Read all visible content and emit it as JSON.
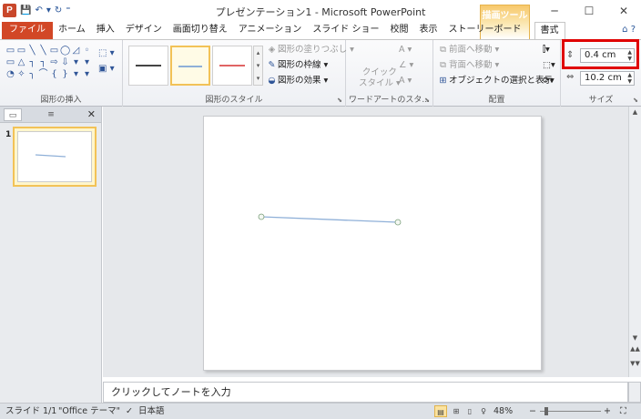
{
  "app": {
    "icon_letter": "P",
    "title": "プレゼンテーション1 - Microsoft PowerPoint",
    "context_tab_group": "描画ツール"
  },
  "qat": {
    "save": "💾",
    "undo": "↶",
    "undo_arrow": "▾",
    "redo": "↻",
    "customize": "⁼"
  },
  "window_controls": {
    "minimize": "─",
    "maximize": "☐",
    "close": "✕"
  },
  "tabs": [
    "ファイル",
    "ホーム",
    "挿入",
    "デザイン",
    "画面切り替え",
    "アニメーション",
    "スライド ショー",
    "校閲",
    "表示",
    "ストーリーボード",
    "書式"
  ],
  "tab_right_icons": {
    "collapse": "⌂",
    "help": "?"
  },
  "ribbon": {
    "insert_shapes": {
      "label": "図形の挿入",
      "shapes": [
        "▭",
        "▭",
        "╲",
        "╲",
        "▭",
        "◯",
        "◿",
        "◦",
        "▭",
        "△",
        "┐",
        "┐",
        "⇨",
        "⇩",
        "▾",
        "▾",
        "◔",
        "✧",
        "╮",
        "⌒",
        "{",
        "}",
        "▾",
        "▾"
      ],
      "side_edit": "⬚ ▾",
      "side_text": "▣ ▾"
    },
    "shape_styles": {
      "label": "図形のスタイル",
      "fill": "図形の塗りつぶし",
      "outline": "図形の枠線",
      "effects": "図形の効果",
      "fill_arrow": "▾",
      "outline_arrow": "▾",
      "effects_arrow": "▾",
      "gallery_colors": [
        "#444444",
        "#8fb0d8",
        "#e06464"
      ]
    },
    "wordart": {
      "label": "ワードアートのスタ...",
      "quick_style_1": "クイック",
      "quick_style_2": "スタイル ▾"
    },
    "arrange": {
      "label": "配置",
      "bring_forward": "前面へ移動",
      "send_backward": "背面へ移動",
      "selection_pane": "オブジェクトの選択と表示",
      "arrow": "▾"
    },
    "size": {
      "label": "サイズ",
      "height": "0.4 cm",
      "width": "10.2 cm"
    }
  },
  "slides_panel": {
    "slide_number": "1",
    "close": "✕",
    "tab_slides": "▭",
    "tab_outline": "≡"
  },
  "notes": {
    "placeholder": "クリックしてノートを入力"
  },
  "status": {
    "slide_info": "スライド 1/1",
    "theme": "\"Office テーマ\"",
    "language": "日本語",
    "zoom": "48%",
    "zoom_minus": "−",
    "zoom_plus": "+"
  },
  "colors": {
    "file_tab": "#d24726",
    "context_tab": "#f7c86b",
    "highlight": "#e00000",
    "line": "#8fb0d8"
  }
}
